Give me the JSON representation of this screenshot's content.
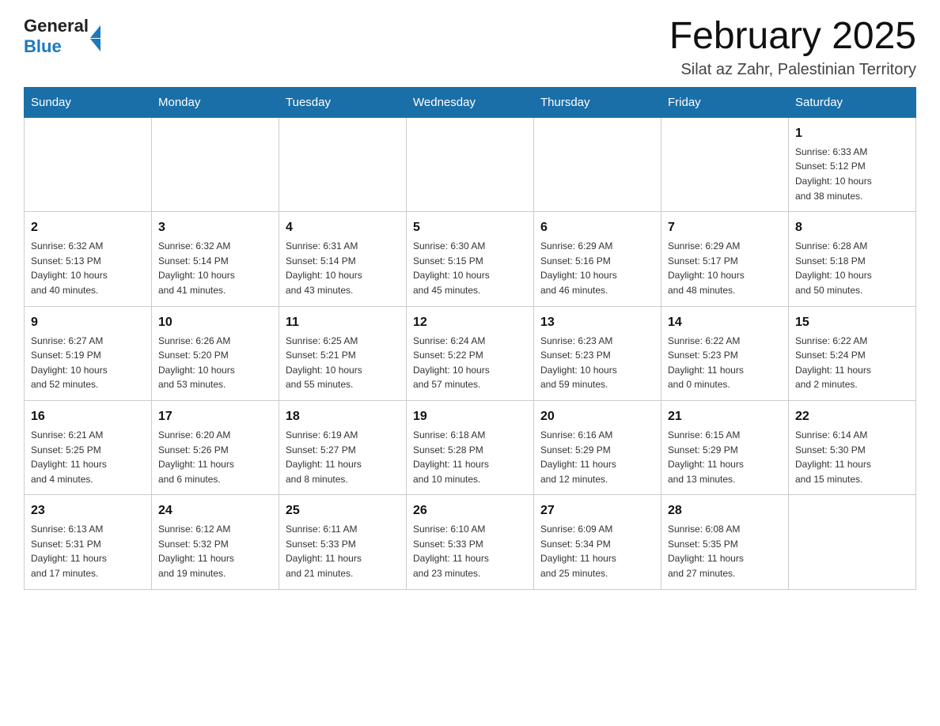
{
  "header": {
    "logo_general": "General",
    "logo_blue": "Blue",
    "main_title": "February 2025",
    "subtitle": "Silat az Zahr, Palestinian Territory"
  },
  "weekdays": [
    "Sunday",
    "Monday",
    "Tuesday",
    "Wednesday",
    "Thursday",
    "Friday",
    "Saturday"
  ],
  "weeks": [
    [
      {
        "day": "",
        "info": ""
      },
      {
        "day": "",
        "info": ""
      },
      {
        "day": "",
        "info": ""
      },
      {
        "day": "",
        "info": ""
      },
      {
        "day": "",
        "info": ""
      },
      {
        "day": "",
        "info": ""
      },
      {
        "day": "1",
        "info": "Sunrise: 6:33 AM\nSunset: 5:12 PM\nDaylight: 10 hours\nand 38 minutes."
      }
    ],
    [
      {
        "day": "2",
        "info": "Sunrise: 6:32 AM\nSunset: 5:13 PM\nDaylight: 10 hours\nand 40 minutes."
      },
      {
        "day": "3",
        "info": "Sunrise: 6:32 AM\nSunset: 5:14 PM\nDaylight: 10 hours\nand 41 minutes."
      },
      {
        "day": "4",
        "info": "Sunrise: 6:31 AM\nSunset: 5:14 PM\nDaylight: 10 hours\nand 43 minutes."
      },
      {
        "day": "5",
        "info": "Sunrise: 6:30 AM\nSunset: 5:15 PM\nDaylight: 10 hours\nand 45 minutes."
      },
      {
        "day": "6",
        "info": "Sunrise: 6:29 AM\nSunset: 5:16 PM\nDaylight: 10 hours\nand 46 minutes."
      },
      {
        "day": "7",
        "info": "Sunrise: 6:29 AM\nSunset: 5:17 PM\nDaylight: 10 hours\nand 48 minutes."
      },
      {
        "day": "8",
        "info": "Sunrise: 6:28 AM\nSunset: 5:18 PM\nDaylight: 10 hours\nand 50 minutes."
      }
    ],
    [
      {
        "day": "9",
        "info": "Sunrise: 6:27 AM\nSunset: 5:19 PM\nDaylight: 10 hours\nand 52 minutes."
      },
      {
        "day": "10",
        "info": "Sunrise: 6:26 AM\nSunset: 5:20 PM\nDaylight: 10 hours\nand 53 minutes."
      },
      {
        "day": "11",
        "info": "Sunrise: 6:25 AM\nSunset: 5:21 PM\nDaylight: 10 hours\nand 55 minutes."
      },
      {
        "day": "12",
        "info": "Sunrise: 6:24 AM\nSunset: 5:22 PM\nDaylight: 10 hours\nand 57 minutes."
      },
      {
        "day": "13",
        "info": "Sunrise: 6:23 AM\nSunset: 5:23 PM\nDaylight: 10 hours\nand 59 minutes."
      },
      {
        "day": "14",
        "info": "Sunrise: 6:22 AM\nSunset: 5:23 PM\nDaylight: 11 hours\nand 0 minutes."
      },
      {
        "day": "15",
        "info": "Sunrise: 6:22 AM\nSunset: 5:24 PM\nDaylight: 11 hours\nand 2 minutes."
      }
    ],
    [
      {
        "day": "16",
        "info": "Sunrise: 6:21 AM\nSunset: 5:25 PM\nDaylight: 11 hours\nand 4 minutes."
      },
      {
        "day": "17",
        "info": "Sunrise: 6:20 AM\nSunset: 5:26 PM\nDaylight: 11 hours\nand 6 minutes."
      },
      {
        "day": "18",
        "info": "Sunrise: 6:19 AM\nSunset: 5:27 PM\nDaylight: 11 hours\nand 8 minutes."
      },
      {
        "day": "19",
        "info": "Sunrise: 6:18 AM\nSunset: 5:28 PM\nDaylight: 11 hours\nand 10 minutes."
      },
      {
        "day": "20",
        "info": "Sunrise: 6:16 AM\nSunset: 5:29 PM\nDaylight: 11 hours\nand 12 minutes."
      },
      {
        "day": "21",
        "info": "Sunrise: 6:15 AM\nSunset: 5:29 PM\nDaylight: 11 hours\nand 13 minutes."
      },
      {
        "day": "22",
        "info": "Sunrise: 6:14 AM\nSunset: 5:30 PM\nDaylight: 11 hours\nand 15 minutes."
      }
    ],
    [
      {
        "day": "23",
        "info": "Sunrise: 6:13 AM\nSunset: 5:31 PM\nDaylight: 11 hours\nand 17 minutes."
      },
      {
        "day": "24",
        "info": "Sunrise: 6:12 AM\nSunset: 5:32 PM\nDaylight: 11 hours\nand 19 minutes."
      },
      {
        "day": "25",
        "info": "Sunrise: 6:11 AM\nSunset: 5:33 PM\nDaylight: 11 hours\nand 21 minutes."
      },
      {
        "day": "26",
        "info": "Sunrise: 6:10 AM\nSunset: 5:33 PM\nDaylight: 11 hours\nand 23 minutes."
      },
      {
        "day": "27",
        "info": "Sunrise: 6:09 AM\nSunset: 5:34 PM\nDaylight: 11 hours\nand 25 minutes."
      },
      {
        "day": "28",
        "info": "Sunrise: 6:08 AM\nSunset: 5:35 PM\nDaylight: 11 hours\nand 27 minutes."
      },
      {
        "day": "",
        "info": ""
      }
    ]
  ]
}
